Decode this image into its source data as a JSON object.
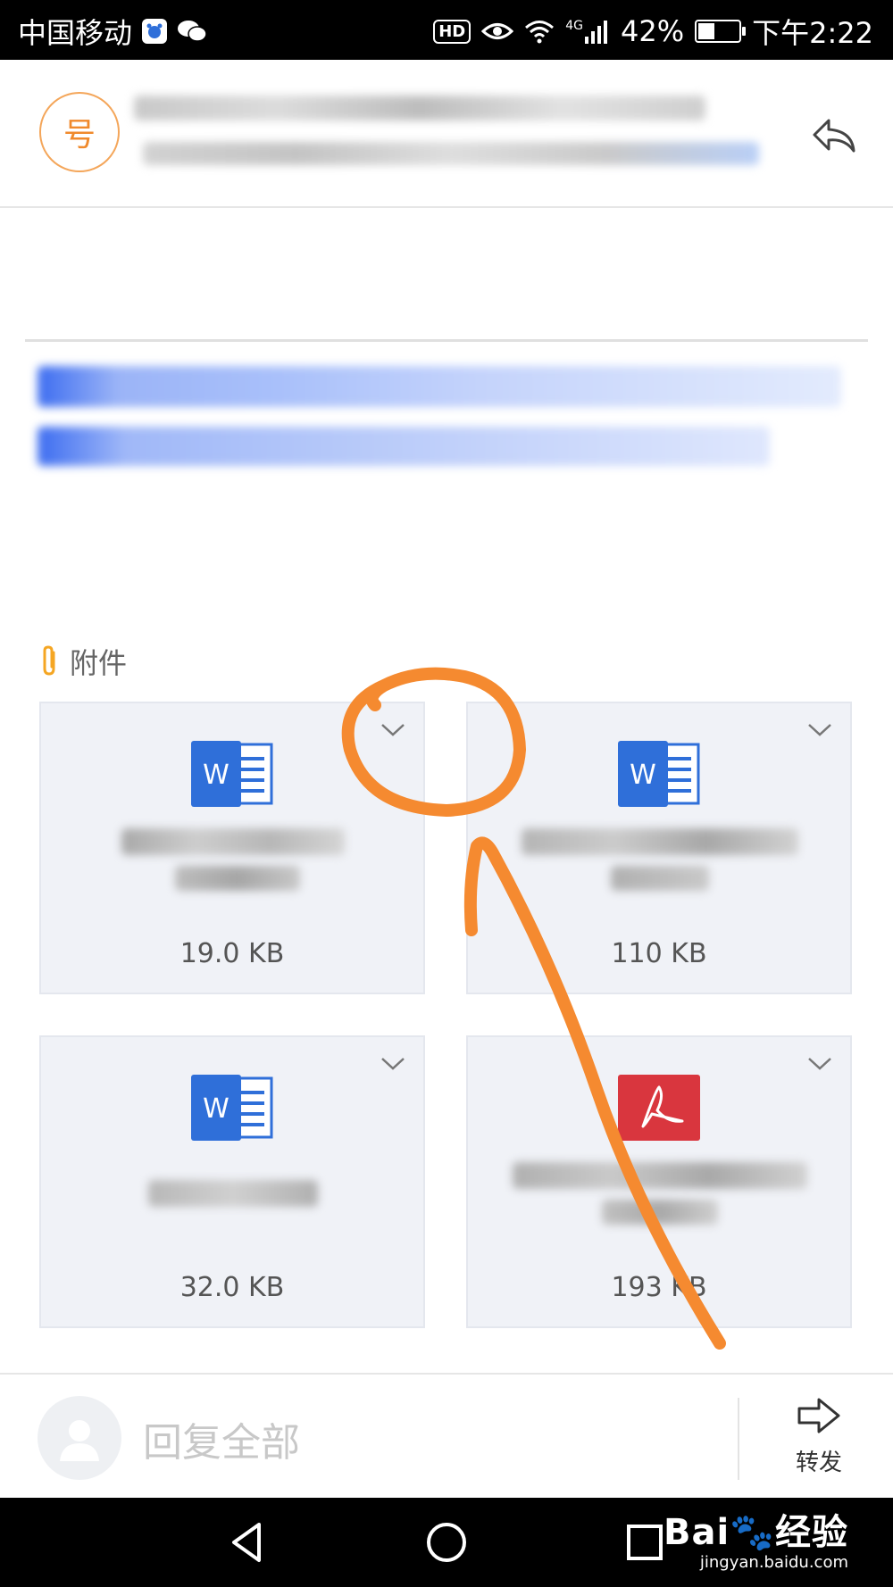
{
  "status_bar": {
    "carrier": "中国移动",
    "network_label": "4G",
    "battery_text": "42%",
    "battery_level": 0.42,
    "time": "下午2:22"
  },
  "header": {
    "sender_avatar_char": "号"
  },
  "attachments": {
    "title": "附件",
    "files": [
      {
        "type": "word",
        "size": "19.0 KB"
      },
      {
        "type": "word",
        "size": "110 KB"
      },
      {
        "type": "word",
        "size": "32.0 KB"
      },
      {
        "type": "pdf",
        "size": "193 KB"
      }
    ]
  },
  "reply_bar": {
    "reply_all_label": "回复全部",
    "forward_label": "转发"
  },
  "watermark": {
    "brand": "Bai",
    "brand_suffix": "经验",
    "url": "jingyan.baidu.com"
  },
  "colors": {
    "accent_blue": "#3d6df0",
    "word_blue": "#2f6fd9",
    "pdf_red": "#d9363e",
    "orange_mark": "#f58a30"
  }
}
